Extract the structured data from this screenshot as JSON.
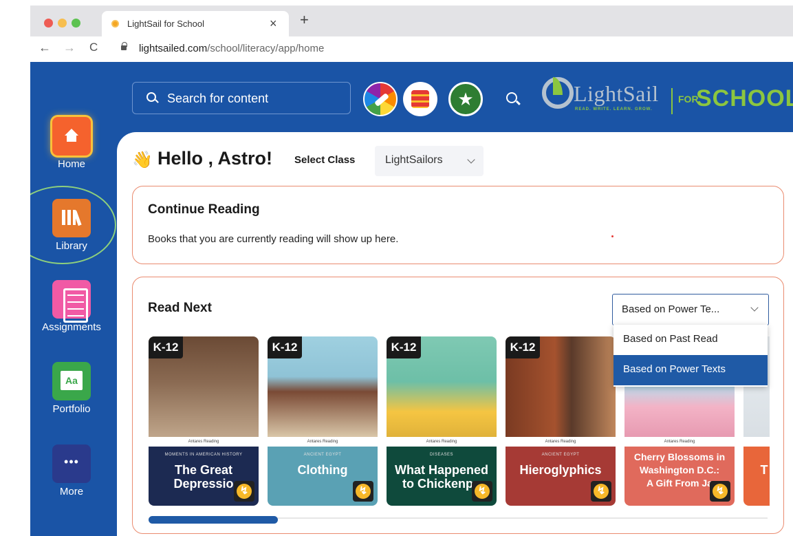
{
  "browser": {
    "tab_title": "LightSail for School",
    "tab_close": "×",
    "new_tab": "+",
    "back": "←",
    "forward": "→",
    "reload": "C",
    "url_host": "lightsailed.com",
    "url_path": "/school/literacy/app/home"
  },
  "header": {
    "search_placeholder": "Search for content",
    "logo_text": "LightSail",
    "logo_tagline": "READ. WRITE. LEARN. GROW.",
    "for_label": "FOR",
    "school_label": "SCHOOL",
    "star_glyph": "★"
  },
  "sidebar": {
    "items": [
      {
        "label": "Home",
        "icon": "home-icon"
      },
      {
        "label": "Library",
        "icon": "library-icon"
      },
      {
        "label": "Assignments",
        "icon": "assignments-icon"
      },
      {
        "label": "Portfolio",
        "icon": "portfolio-icon"
      },
      {
        "label": "More",
        "icon": "more-icon"
      }
    ]
  },
  "main": {
    "wave_emoji": "👋",
    "greeting": "Hello , Astro!",
    "select_class_label": "Select Class",
    "selected_class": "LightSailors",
    "continue_reading": {
      "title": "Continue Reading",
      "description": "Books that you are currently reading will show up here."
    },
    "read_next": {
      "title": "Read Next",
      "sort_selected": "Based on Power Te...",
      "sort_options": [
        "Based on Past Read",
        "Based on Power Texts"
      ],
      "books": [
        {
          "grade": "K-12",
          "publisher": "Antares Reading",
          "series": "MOMENTS IN AMERICAN HISTORY",
          "title": "The Great\nDepressio"
        },
        {
          "grade": "K-12",
          "publisher": "Antares Reading",
          "series": "ANCIENT EGYPT",
          "title": "Clothing"
        },
        {
          "grade": "K-12",
          "publisher": "Antares Reading",
          "series": "DISEASES",
          "title": "What Happened\nto Chickenpo"
        },
        {
          "grade": "K-12",
          "publisher": "Antares Reading",
          "series": "ANCIENT EGYPT",
          "title": "Hieroglyphics"
        },
        {
          "grade": "",
          "publisher": "Antares Reading",
          "series": "",
          "title": "Cherry Blossoms in\nWashington D.C.:\nA Gift From Ja"
        },
        {
          "grade": "",
          "publisher": "",
          "series": "",
          "title": "T"
        }
      ]
    }
  },
  "colors": {
    "app_blue": "#1a54a6",
    "card_border": "#ea8b6f",
    "selected_option": "#1f5aa6",
    "logo_green": "#8cc63f"
  }
}
